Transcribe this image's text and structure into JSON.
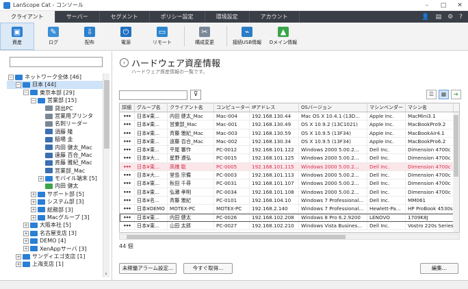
{
  "window": {
    "title": "LanScope Cat - コンソール",
    "controls": [
      "–",
      "□",
      "✕"
    ]
  },
  "tabs": [
    "クライアント",
    "サーバー",
    "セグメント",
    "ポリシー設定",
    "環境設定",
    "アカウント"
  ],
  "active_tab": 0,
  "tabbar_icons": [
    "user-icon",
    "calendar-icon",
    "gear-icon",
    "help-icon"
  ],
  "toolbar": [
    {
      "label": "資産",
      "icon": "asset-icon",
      "color": "#2a7fd4",
      "active": true
    },
    {
      "label": "ログ",
      "icon": "log-icon",
      "color": "#3b8fd8"
    },
    {
      "label": "配布",
      "icon": "distribute-icon",
      "color": "#2b80cc"
    },
    {
      "label": "電源",
      "icon": "power-icon",
      "color": "#1f6fbf"
    },
    {
      "label": "リモート",
      "icon": "remote-icon",
      "color": "#2d86d0"
    },
    {
      "label": "構成変更",
      "icon": "config-icon",
      "color": "#7a8796"
    },
    {
      "label": "接続USB情報",
      "icon": "usb-icon",
      "color": "#2c7cc6"
    },
    {
      "label": "Dメイン情報",
      "icon": "domain-icon",
      "color": "#3aa54a"
    }
  ],
  "tree": [
    {
      "label": "ネットワーク全体 [46]",
      "level": 0,
      "exp": "−",
      "color": "#2a7fd4"
    },
    {
      "label": "日本 [44]",
      "level": 1,
      "exp": "−",
      "color": "#2a7fd4",
      "selected": true
    },
    {
      "label": "東京本部 [29]",
      "level": 2,
      "exp": "−",
      "color": "#2a7fd4"
    },
    {
      "label": "営業部 [15]",
      "level": 3,
      "exp": "−",
      "color": "#2a7fd4"
    },
    {
      "label": "貸出PC",
      "level": 4,
      "exp": "",
      "color": "#7a8796"
    },
    {
      "label": "営業用プリンタ",
      "level": 4,
      "exp": "",
      "color": "#7a8796"
    },
    {
      "label": "名刺リーダー",
      "level": 4,
      "exp": "",
      "color": "#7a8796"
    },
    {
      "label": "須藤 隆",
      "level": 4,
      "exp": "",
      "color": "#3b6fb0"
    },
    {
      "label": "稲場 圭",
      "level": 4,
      "exp": "",
      "color": "#3b6fb0"
    },
    {
      "label": "内田 健太_Mac",
      "level": 4,
      "exp": "",
      "color": "#3b6fb0"
    },
    {
      "label": "遠藤 百合_Mac",
      "level": 4,
      "exp": "",
      "color": "#3b6fb0"
    },
    {
      "label": "斉藤 雅紀_Mac",
      "level": 4,
      "exp": "",
      "color": "#3b6fb0"
    },
    {
      "label": "営業部_Mac",
      "level": 4,
      "exp": "",
      "color": "#3b6fb0"
    },
    {
      "label": "モバイル端末 [5]",
      "level": 4,
      "exp": "+",
      "color": "#2a7fd4"
    },
    {
      "label": "内田 健太",
      "level": 4,
      "exp": "",
      "color": "#3aa54a"
    },
    {
      "label": "サポート部 [5]",
      "level": 3,
      "exp": "+",
      "color": "#2a7fd4"
    },
    {
      "label": "システム部 [3]",
      "level": 3,
      "exp": "+",
      "color": "#2a7fd4"
    },
    {
      "label": "総務部 [3]",
      "level": 3,
      "exp": "+",
      "color": "#2a7fd4"
    },
    {
      "label": "Macグループ [3]",
      "level": 3,
      "exp": "+",
      "color": "#2a7fd4"
    },
    {
      "label": "大阪本社 [5]",
      "level": 2,
      "exp": "+",
      "color": "#2a7fd4"
    },
    {
      "label": "名古屋支店 [3]",
      "level": 2,
      "exp": "+",
      "color": "#2a7fd4"
    },
    {
      "label": "DEMO [4]",
      "level": 2,
      "exp": "+",
      "color": "#2a7fd4"
    },
    {
      "label": "XenAppサーバ [3]",
      "level": 2,
      "exp": "+",
      "color": "#2a7fd4"
    },
    {
      "label": "サンディエゴ支店 [1]",
      "level": 1,
      "exp": "+",
      "color": "#2a7fd4"
    },
    {
      "label": "上海支店 [1]",
      "level": 1,
      "exp": "+",
      "color": "#2a7fd4"
    }
  ],
  "page": {
    "title": "ハードウェア資産情報",
    "subtitle": "ハードウェア資産情報の一覧です。"
  },
  "columns": [
    "詳細",
    "グループ名",
    "クライアント名",
    "コンピューター名",
    "IPアドレス",
    "OSバージョン",
    "マシンベンダー",
    "マシン名"
  ],
  "col_widths": [
    22,
    48,
    68,
    52,
    72,
    100,
    56,
    70
  ],
  "rows": [
    [
      "•••",
      "日本¥東...",
      "内田 健太_Mac",
      "Mac-004",
      "192.168.130.44",
      "Mac OS X 10.4.1 (13D...",
      "Apple Inc.",
      "MacMini3.1"
    ],
    [
      "•••",
      "日本¥東...",
      "営業部_Mac",
      "Mac-001",
      "192.168.130.49",
      "OS X 10.9.2 (13C1021)",
      "Apple Inc.",
      "MacBookPro9.2"
    ],
    [
      "•••",
      "日本¥東...",
      "斉藤 雅紀_Mac",
      "Mac-003",
      "192.168.130.59",
      "OS X 10.9.5 (13F34)",
      "Apple Inc.",
      "MacBookAir4.1"
    ],
    [
      "•••",
      "日本¥東...",
      "遠藤 百合_Mac",
      "Mac-002",
      "192.168.130.34",
      "OS X 10.9.5 (13F34)",
      "Apple Inc.",
      "MacBookPro6.2"
    ],
    [
      "•••",
      "日本¥東...",
      "平尾 審作",
      "PC-0012",
      "192.168.101.122",
      "Windows 2000  5.00.2...",
      "Dell Inc.",
      "Dimension 4700c"
    ],
    [
      "•••",
      "日本¥大...",
      "星野 遵弘",
      "PC-0015",
      "192.168.101.125",
      "Windows 2000  5.00.2...",
      "Dell Inc.",
      "Dimension 4700c"
    ],
    [
      "•••",
      "日本¥東...",
      "高橋 聡",
      "PC-0005",
      "192.168.101.115",
      "Windows 2000  5.00.2...",
      "Dell Inc.",
      "Dimension 4700c"
    ],
    [
      "•••",
      "日本¥大...",
      "堂島 宗備",
      "PC-0003",
      "192.168.101.113",
      "Windows 2000  5.00.2...",
      "Dell Inc.",
      "Dimension 4700c"
    ],
    [
      "•••",
      "日本¥東...",
      "秋田 千尋",
      "PC-0031",
      "192.168.101.107",
      "Windows 2000  5.00.2...",
      "Dell Inc.",
      "Dimension 4700c"
    ],
    [
      "•••",
      "日本¥東...",
      "弘瀬 孝明",
      "PC-0034",
      "192.168.101.108",
      "Windows 2000  5.00.2...",
      "Dell Inc.",
      "Dimension 4700c"
    ],
    [
      "•••",
      "日本¥名...",
      "斉藤 雅紀",
      "PC-0101",
      "192.168.104.10",
      "Windows 7 Professional...",
      "Dell Inc.",
      "MM061"
    ],
    [
      "•••",
      "日本¥DEMO",
      "MOTEX-PC",
      "MOTEX-PC",
      "192.168.2.140",
      "Windows 7 Professional...",
      "Hewlett-Pa...",
      "HP ProBook 4530s"
    ],
    [
      "•••",
      "日本¥東...",
      "内田 健太",
      "PC-0026",
      "192.168.102.208",
      "Windows 8 Pro  6.2.9200",
      "LENOVO",
      "1709K8J"
    ],
    [
      "•••",
      "日本¥東...",
      "山田 太郎",
      "PC-0027",
      "192.168.102.210",
      "Windows Vista Busines...",
      "Dell Inc.",
      "Vostro 220s Series"
    ]
  ],
  "highlight_row": 6,
  "focus_row": 12,
  "count": "44 個",
  "buttons": {
    "alarm": "未稼働アラーム設定...",
    "fetch": "今すぐ取得...",
    "edit": "編集..."
  }
}
